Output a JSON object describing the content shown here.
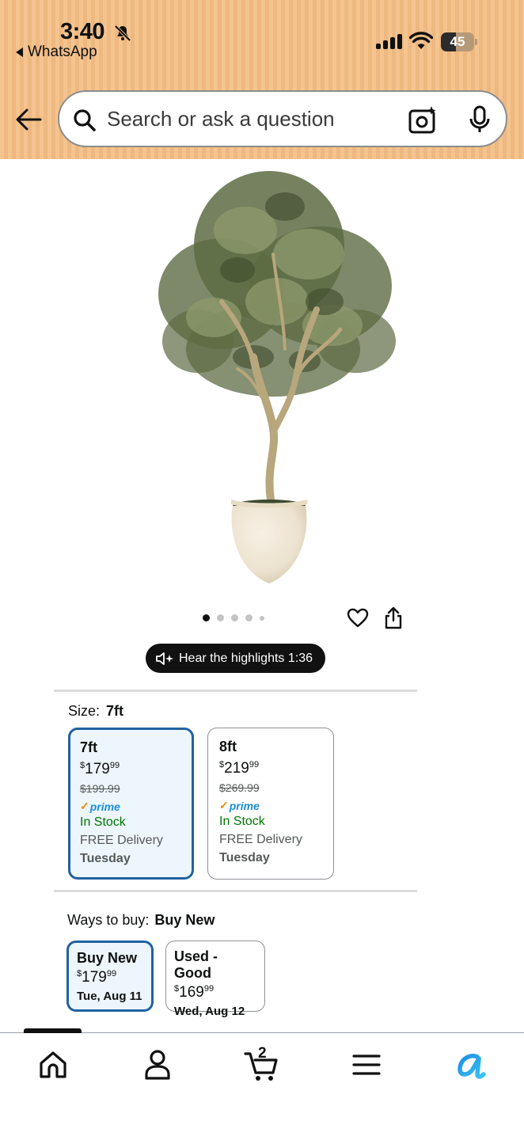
{
  "status_bar": {
    "time": "3:40",
    "back_app": "WhatsApp",
    "battery": "45",
    "battery_level": 0.45
  },
  "search": {
    "placeholder": "Search or ask a question"
  },
  "carousel": {
    "total_images": 5,
    "active_index": 0
  },
  "audio": {
    "label": "Hear the highlights 1:36"
  },
  "size": {
    "label": "Size:",
    "selected": "7ft",
    "options": [
      {
        "title": "7ft",
        "price_dollar": "$",
        "price_main": "179",
        "price_cents": "99",
        "was_price": "$199.99",
        "prime": "prime",
        "stock": "In Stock",
        "delivery": "FREE Delivery",
        "day": "Tuesday"
      },
      {
        "title": "8ft",
        "price_dollar": "$",
        "price_main": "219",
        "price_cents": "99",
        "was_price": "$269.99",
        "prime": "prime",
        "stock": "In Stock",
        "delivery": "FREE Delivery",
        "day": "Tuesday"
      }
    ]
  },
  "ways_to_buy": {
    "label": "Ways to buy:",
    "selected": "Buy New",
    "options": [
      {
        "title": "Buy New",
        "price_dollar": "$",
        "price_main": "179",
        "price_cents": "99",
        "date": "Tue, Aug 11"
      },
      {
        "title": "Used - Good",
        "price_dollar": "$",
        "price_main": "169",
        "price_cents": "99",
        "date": "Wed, Aug 12"
      }
    ]
  },
  "tabbar": {
    "cart_count": "2",
    "tabs": [
      "home-icon",
      "account-icon",
      "cart-icon",
      "menu-icon",
      "rufus-icon"
    ]
  },
  "colors": {
    "header_bg": "#f4c48f",
    "selected_border": "#2162a1",
    "selected_bg": "#edf6fd",
    "in_stock": "#007600",
    "prime_blue": "#1a8fd9",
    "prime_check": "#f08804"
  }
}
